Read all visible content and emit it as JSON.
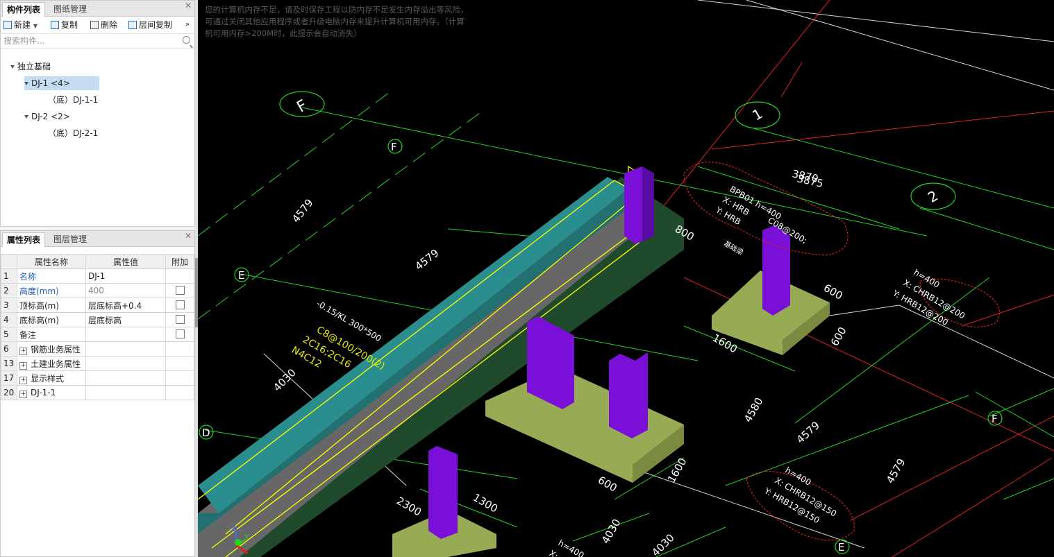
{
  "component_panel": {
    "tabs": [
      "构件列表",
      "图纸管理"
    ],
    "toolbar": {
      "new_label": "新建",
      "copy_label": "复制",
      "delete_label": "删除",
      "floor_copy_label": "层间复制"
    },
    "search_placeholder": "搜索构件...",
    "tree": {
      "root": "独立基础",
      "items": [
        {
          "label": "DJ-1 <4>",
          "child": "（底）DJ-1-1"
        },
        {
          "label": "DJ-2 <2>",
          "child": "（底）DJ-2-1"
        }
      ]
    }
  },
  "property_panel": {
    "tabs": [
      "属性列表",
      "图层管理"
    ],
    "headers": [
      "属性名称",
      "属性值",
      "附加"
    ],
    "rows": [
      {
        "num": "1",
        "name": "名称",
        "value": "DJ-1"
      },
      {
        "num": "2",
        "name": "高度(mm)",
        "value": "400"
      },
      {
        "num": "3",
        "name": "顶标高(m)",
        "value": "层底标高+0.4"
      },
      {
        "num": "4",
        "name": "底标高(m)",
        "value": "层底标高"
      },
      {
        "num": "5",
        "name": "备注",
        "value": ""
      },
      {
        "num": "6",
        "name": "钢筋业务属性",
        "value": ""
      },
      {
        "num": "13",
        "name": "土建业务属性",
        "value": ""
      },
      {
        "num": "17",
        "name": "显示样式",
        "value": ""
      },
      {
        "num": "20",
        "name": "DJ-1-1",
        "value": ""
      }
    ]
  },
  "viewport": {
    "memory_warning": "您的计算机内存不足，请及时保存工程以防内存不足发生内存溢出等风险，可通过关闭其他应用程序或者升级电脑内存来提升计算机可用内存。（计算机可用内存>200M时，此提示会自动消失）",
    "axis_labels": {
      "F": "F",
      "E": "E",
      "D": "D",
      "one": "1",
      "two": "2"
    },
    "dimensions": {
      "d4579a": "4579",
      "d4579b": "4579",
      "d4579c": "4579",
      "d4579d": "4579",
      "d3870": "3870",
      "d3875": "3875",
      "d800": "800",
      "d600a": "600",
      "d600b": "600",
      "d600c": "600",
      "d1600a": "1600",
      "d1600b": "1600",
      "d4580": "4580",
      "d4030a": "4030",
      "d4030b": "4030",
      "d4030c": "4030",
      "d1300": "1300",
      "d2300": "2300"
    },
    "beam_annotation": [
      "-0.15/KL 300*500",
      "C8@100/200(2)",
      "2C16;2C16",
      "N4C12"
    ],
    "slab_annotation_top": [
      "BPB01 h=400",
      "X: HRB",
      "Y: HRB",
      "C08@200;"
    ],
    "slab_annotation_right": [
      "h=400",
      "X: CHRB12@200",
      "Y: HRB12@200"
    ],
    "slab_annotation_bottom": [
      "h=400",
      "X: CHRB12@150",
      "Y: HRB12@150"
    ],
    "slab_annotation_partial": [
      "h=400",
      "X:"
    ],
    "small_label": "基础梁",
    "axes": {
      "z": "Z",
      "y": "Y"
    }
  }
}
